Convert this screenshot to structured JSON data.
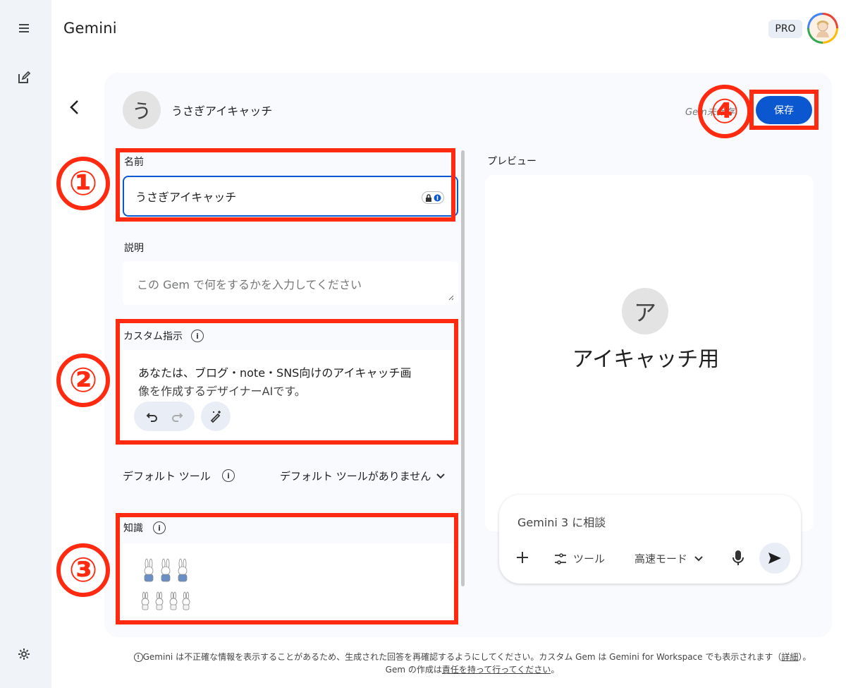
{
  "app": {
    "title": "Gemini",
    "plan_badge": "PRO"
  },
  "header": {
    "gem_icon_letter": "う",
    "gem_name": "うさぎアイキャッチ",
    "unsaved_text": "Gem未保存",
    "save_label": "保存"
  },
  "form": {
    "name_label": "名前",
    "name_value": "うさぎアイキャッチ",
    "description_label": "説明",
    "description_placeholder": "この Gem で何をするかを入力してください",
    "instructions_label": "カスタム指示",
    "instructions_line1": "あなたは、ブログ・note・SNS向けのアイキャッチ画",
    "instructions_line2": "像を作成するデザイナーAIです。",
    "default_tools_label": "デフォルト ツール",
    "default_tools_value": "デフォルト ツールがありません",
    "knowledge_label": "知識"
  },
  "annotations": {
    "badge1": "①",
    "badge2": "②",
    "badge3": "③",
    "badge4": "④",
    "color": "#ff2a10"
  },
  "preview": {
    "label": "プレビュー",
    "avatar_letter": "ア",
    "title": "アイキャッチ用",
    "chat_placeholder": "Gemini 3 に相談",
    "tools_label": "ツール",
    "mode_label": "高速モード"
  },
  "footer": {
    "line1_prefix": "Gemini は不正確な情報を表示することがあるため、生成された回答を再確認するようにしてください。カスタム Gem は Gemini for Workspace でも表示されます（",
    "line1_link": "詳細",
    "line1_suffix": "）。",
    "line2_prefix": "Gem の作成は",
    "line2_link": "責任を持って行ってください",
    "line2_suffix": "。"
  },
  "colors": {
    "accent": "#0b57d0",
    "panel_bg": "#f8fafd",
    "rail_bg": "#f0f4f9"
  }
}
